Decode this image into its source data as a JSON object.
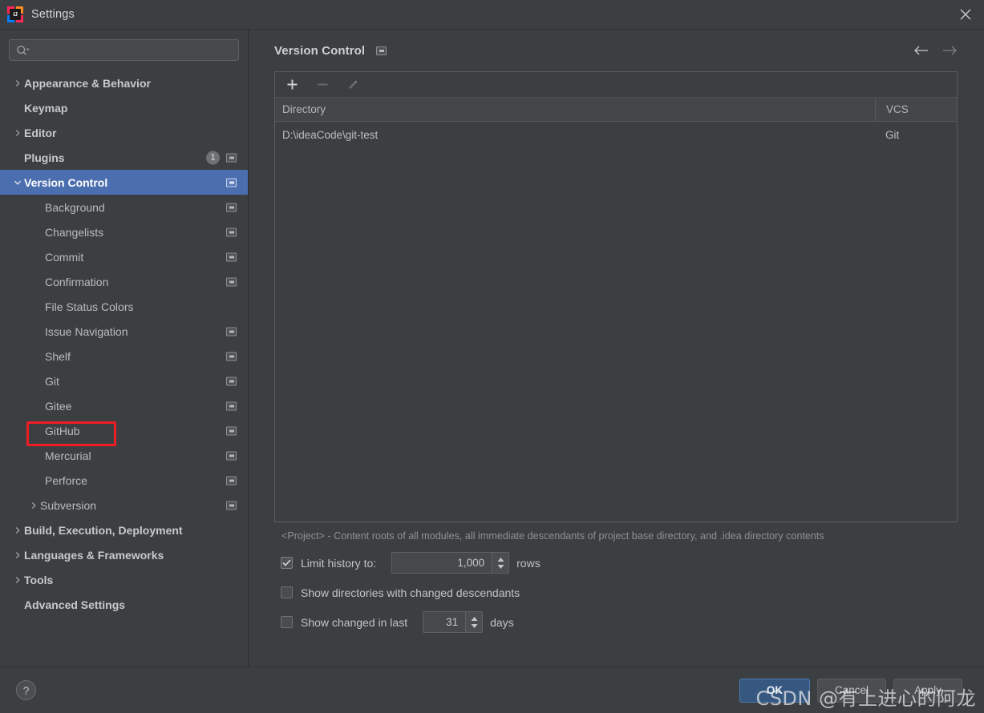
{
  "window": {
    "title": "Settings",
    "logo_text": "IJ",
    "close_icon": "close-icon"
  },
  "sidebar": {
    "search": {
      "placeholder": "",
      "value": "",
      "icon": "search-icon"
    },
    "items": [
      {
        "label": "Appearance & Behavior",
        "depth": 0,
        "arrow": "right",
        "bold": true,
        "badge": false,
        "selected": false
      },
      {
        "label": "Keymap",
        "depth": 0,
        "arrow": "",
        "bold": true,
        "badge": false,
        "selected": false
      },
      {
        "label": "Editor",
        "depth": 0,
        "arrow": "right",
        "bold": true,
        "badge": false,
        "selected": false
      },
      {
        "label": "Plugins",
        "depth": 0,
        "arrow": "",
        "bold": true,
        "badge": true,
        "selected": false,
        "count": "1"
      },
      {
        "label": "Version Control",
        "depth": 0,
        "arrow": "down",
        "bold": true,
        "badge": true,
        "selected": true
      },
      {
        "label": "Background",
        "depth": 1,
        "arrow": "",
        "bold": false,
        "badge": true,
        "selected": false
      },
      {
        "label": "Changelists",
        "depth": 1,
        "arrow": "",
        "bold": false,
        "badge": true,
        "selected": false
      },
      {
        "label": "Commit",
        "depth": 1,
        "arrow": "",
        "bold": false,
        "badge": true,
        "selected": false
      },
      {
        "label": "Confirmation",
        "depth": 1,
        "arrow": "",
        "bold": false,
        "badge": true,
        "selected": false
      },
      {
        "label": "File Status Colors",
        "depth": 1,
        "arrow": "",
        "bold": false,
        "badge": false,
        "selected": false
      },
      {
        "label": "Issue Navigation",
        "depth": 1,
        "arrow": "",
        "bold": false,
        "badge": true,
        "selected": false
      },
      {
        "label": "Shelf",
        "depth": 1,
        "arrow": "",
        "bold": false,
        "badge": true,
        "selected": false
      },
      {
        "label": "Git",
        "depth": 1,
        "arrow": "",
        "bold": false,
        "badge": true,
        "selected": false
      },
      {
        "label": "Gitee",
        "depth": 1,
        "arrow": "",
        "bold": false,
        "badge": true,
        "selected": false
      },
      {
        "label": "GitHub",
        "depth": 1,
        "arrow": "",
        "bold": false,
        "badge": true,
        "selected": false,
        "highlighted": true
      },
      {
        "label": "Mercurial",
        "depth": 1,
        "arrow": "",
        "bold": false,
        "badge": true,
        "selected": false
      },
      {
        "label": "Perforce",
        "depth": 1,
        "arrow": "",
        "bold": false,
        "badge": true,
        "selected": false
      },
      {
        "label": "Subversion",
        "depth": 1,
        "arrow": "right",
        "bold": false,
        "badge": true,
        "selected": false
      },
      {
        "label": "Build, Execution, Deployment",
        "depth": 0,
        "arrow": "right",
        "bold": true,
        "badge": false,
        "selected": false
      },
      {
        "label": "Languages & Frameworks",
        "depth": 0,
        "arrow": "right",
        "bold": true,
        "badge": false,
        "selected": false
      },
      {
        "label": "Tools",
        "depth": 0,
        "arrow": "right",
        "bold": true,
        "badge": false,
        "selected": false
      },
      {
        "label": "Advanced Settings",
        "depth": 0,
        "arrow": "",
        "bold": true,
        "badge": false,
        "selected": false
      }
    ]
  },
  "main": {
    "page_title": "Version Control",
    "nav": {
      "back_icon": "arrow-left-icon",
      "forward_icon": "arrow-right-icon"
    },
    "toolbar": [
      {
        "name": "add-button",
        "icon": "plus-icon",
        "disabled": false
      },
      {
        "name": "remove-button",
        "icon": "minus-icon",
        "disabled": true
      },
      {
        "name": "edit-button",
        "icon": "pencil-icon",
        "disabled": true
      }
    ],
    "table": {
      "columns": [
        "Directory",
        "VCS"
      ],
      "rows": [
        {
          "directory": "D:\\ideaCode\\git-test",
          "vcs": "Git"
        }
      ]
    },
    "hint": "<Project> - Content roots of all modules, all immediate descendants of project base directory, and .idea directory contents",
    "options": {
      "limit_history": {
        "label": "Limit history to:",
        "checked": true,
        "value": "1,000",
        "unit": "rows"
      },
      "show_directories": {
        "label": "Show directories with changed descendants",
        "checked": false
      },
      "show_changed": {
        "label": "Show changed in last",
        "checked": false,
        "value": "31",
        "unit": "days"
      }
    }
  },
  "footer": {
    "help_label": "?",
    "ok_label": "OK",
    "cancel_label": "Cancel",
    "apply_label": "Apply",
    "watermark": "CSDN @有上进心的阿龙"
  }
}
